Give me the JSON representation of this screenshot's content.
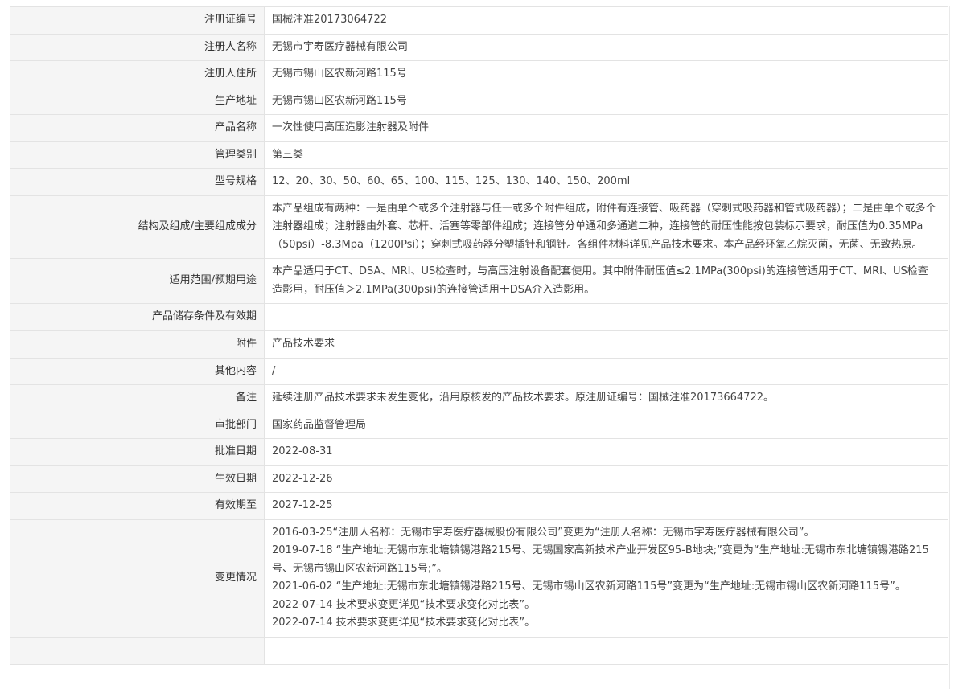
{
  "rows": [
    {
      "label": "注册证编号",
      "value": "国械注准20173064722"
    },
    {
      "label": "注册人名称",
      "value": "无锡市宇寿医疗器械有限公司"
    },
    {
      "label": "注册人住所",
      "value": "无锡市锡山区农新河路115号"
    },
    {
      "label": "生产地址",
      "value": "无锡市锡山区农新河路115号"
    },
    {
      "label": "产品名称",
      "value": "一次性使用高压造影注射器及附件"
    },
    {
      "label": "管理类别",
      "value": "第三类"
    },
    {
      "label": "型号规格",
      "value": "12、20、30、50、60、65、100、115、125、130、140、150、200ml"
    },
    {
      "label": "结构及组成/主要组成成分",
      "value": "本产品组成有两种：一是由单个或多个注射器与任一或多个附件组成，附件有连接管、吸药器（穿刺式吸药器和管式吸药器）；二是由单个或多个注射器组成；注射器由外套、芯杆、活塞等零部件组成；连接管分单通和多通道二种，连接管的耐压性能按包装标示要求，耐压值为0.35MPa（50psi）-8.3Mpa（1200Psi）；穿刺式吸药器分塑插针和钢针。各组件材料详见产品技术要求。本产品经环氧乙烷灭菌，无菌、无致热原。"
    },
    {
      "label": "适用范围/预期用途",
      "value": "本产品适用于CT、DSA、MRI、US检查时，与高压注射设备配套使用。其中附件耐压值≤2.1MPa(300psi)的连接管适用于CT、MRI、US检查造影用，耐压值＞2.1MPa(300psi)的连接管适用于DSA介入造影用。"
    },
    {
      "label": "产品储存条件及有效期",
      "value": ""
    },
    {
      "label": "附件",
      "value": "产品技术要求"
    },
    {
      "label": "其他内容",
      "value": "/"
    },
    {
      "label": "备注",
      "value": "延续注册产品技术要求未发生变化，沿用原核发的产品技术要求。原注册证编号：国械注准20173664722。"
    },
    {
      "label": "审批部门",
      "value": "国家药品监督管理局"
    },
    {
      "label": "批准日期",
      "value": "2022-08-31"
    },
    {
      "label": "生效日期",
      "value": "2022-12-26"
    },
    {
      "label": "有效期至",
      "value": "2027-12-25"
    }
  ],
  "changes": {
    "label": "变更情况",
    "items": [
      "2016-03-25“注册人名称：无锡市宇寿医疗器械股份有限公司”变更为“注册人名称：无锡市宇寿医疗器械有限公司”。",
      "2019-07-18 “生产地址:无锡市东北塘镇锡港路215号、无锡国家高新技术产业开发区95-B地块;”变更为“生产地址:无锡市东北塘镇锡港路215号、无锡市锡山区农新河路115号;”。",
      "2021-06-02 “生产地址:无锡市东北塘镇锡港路215号、无锡市锡山区农新河路115号”变更为“生产地址:无锡市锡山区农新河路115号”。",
      "2022-07-14 技术要求变更详见“技术要求变化对比表”。",
      "2022-07-14 技术要求变更详见“技术要求变化对比表”。"
    ]
  }
}
